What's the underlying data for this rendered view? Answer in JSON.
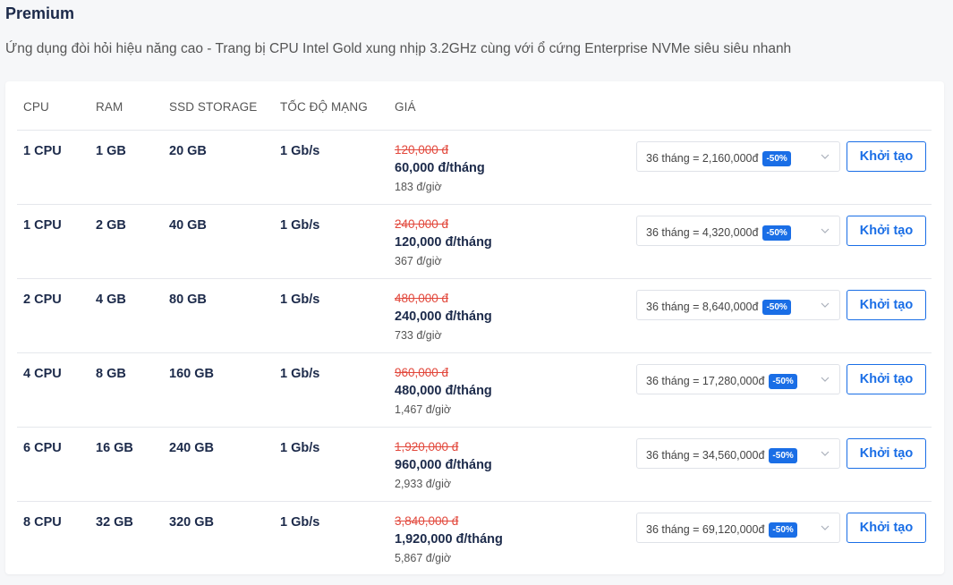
{
  "section": {
    "title": "Premium",
    "subtitle": "Ứng dụng đòi hỏi hiệu năng cao - Trang bị CPU Intel Gold xung nhịp 3.2GHz cùng với ổ cứng Enterprise NVMe siêu siêu nhanh"
  },
  "table": {
    "headers": {
      "cpu": "CPU",
      "ram": "RAM",
      "ssd": "SSD STORAGE",
      "network": "TỐC ĐỘ MẠNG",
      "price": "GIÁ"
    },
    "rows": [
      {
        "cpu": "1 CPU",
        "ram": "1 GB",
        "ssd": "20 GB",
        "network": "1 Gb/s",
        "old_price": "120,000 đ",
        "month_price": "60,000 đ/tháng",
        "hour_price": "183 đ/giờ",
        "term": "36 tháng = 2,160,000đ",
        "discount": "-50%",
        "button": "Khởi tạo"
      },
      {
        "cpu": "1 CPU",
        "ram": "2 GB",
        "ssd": "40 GB",
        "network": "1 Gb/s",
        "old_price": "240,000 đ",
        "month_price": "120,000 đ/tháng",
        "hour_price": "367 đ/giờ",
        "term": "36 tháng = 4,320,000đ",
        "discount": "-50%",
        "button": "Khởi tạo"
      },
      {
        "cpu": "2 CPU",
        "ram": "4 GB",
        "ssd": "80 GB",
        "network": "1 Gb/s",
        "old_price": "480,000 đ",
        "month_price": "240,000 đ/tháng",
        "hour_price": "733 đ/giờ",
        "term": "36 tháng = 8,640,000đ",
        "discount": "-50%",
        "button": "Khởi tạo"
      },
      {
        "cpu": "4 CPU",
        "ram": "8 GB",
        "ssd": "160 GB",
        "network": "1 Gb/s",
        "old_price": "960,000 đ",
        "month_price": "480,000 đ/tháng",
        "hour_price": "1,467 đ/giờ",
        "term": "36 tháng = 17,280,000đ",
        "discount": "-50%",
        "button": "Khởi tạo"
      },
      {
        "cpu": "6 CPU",
        "ram": "16 GB",
        "ssd": "240 GB",
        "network": "1 Gb/s",
        "old_price": "1,920,000 đ",
        "month_price": "960,000 đ/tháng",
        "hour_price": "2,933 đ/giờ",
        "term": "36 tháng = 34,560,000đ",
        "discount": "-50%",
        "button": "Khởi tạo"
      },
      {
        "cpu": "8 CPU",
        "ram": "32 GB",
        "ssd": "320 GB",
        "network": "1 Gb/s",
        "old_price": "3,840,000 đ",
        "month_price": "1,920,000 đ/tháng",
        "hour_price": "5,867 đ/giờ",
        "term": "36 tháng = 69,120,000đ",
        "discount": "-50%",
        "button": "Khởi tạo"
      }
    ]
  },
  "icons": {
    "select_arrow": "chevron-down-icon"
  },
  "colors": {
    "accent": "#1a6ee6",
    "old_price": "#e2483c",
    "text": "#1c2a4a"
  }
}
